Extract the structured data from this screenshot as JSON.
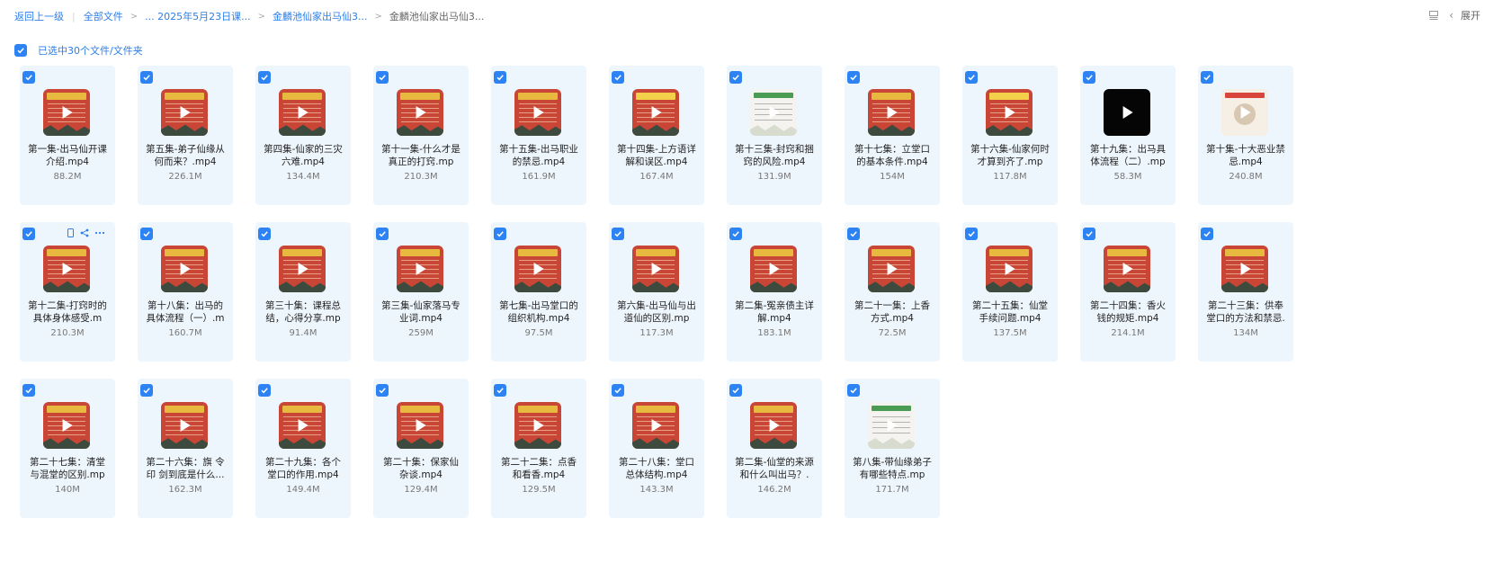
{
  "breadcrumb": {
    "back": "返回上一级",
    "items": [
      "全部文件",
      "... 2025年5月23日课...",
      "金麟池仙家出马仙3..."
    ],
    "current": "金麟池仙家出马仙3..."
  },
  "toolbar": {
    "expand_label": "展开",
    "chevron": "‹"
  },
  "selection": {
    "label": "已选中30个文件/文件夹"
  },
  "hover_icons": [
    "phone-icon",
    "share-icon",
    "more-icon"
  ],
  "files": [
    {
      "name": "第一集-出马仙开课介绍.mp4",
      "size": "88.2M",
      "thumb": "red"
    },
    {
      "name": "第五集-弟子仙缘从何而来？.mp4",
      "size": "226.1M",
      "thumb": "red"
    },
    {
      "name": "第四集-仙家的三灾六难.mp4",
      "size": "134.4M",
      "thumb": "red"
    },
    {
      "name": "第十一集-什么才是真正的打窍.mp",
      "size": "210.3M",
      "thumb": "red"
    },
    {
      "name": "第十五集-出马职业的禁忌.mp4",
      "size": "161.9M",
      "thumb": "red"
    },
    {
      "name": "第十四集-上方语详解和误区.mp4",
      "size": "167.4M",
      "thumb": "yellow"
    },
    {
      "name": "第十三集-封窍和捆窍的风险.mp4",
      "size": "131.9M",
      "thumb": "white"
    },
    {
      "name": "第十七集：立堂口的基本条件.mp4",
      "size": "154M",
      "thumb": "red"
    },
    {
      "name": "第十六集-仙家何时才算到齐了.mp",
      "size": "117.8M",
      "thumb": "yellow"
    },
    {
      "name": "第十九集：出马具体流程（二）.mp",
      "size": "58.3M",
      "thumb": "black"
    },
    {
      "name": "第十集-十大恶业禁忌.mp4",
      "size": "240.8M",
      "thumb": "portrait"
    },
    {
      "name": "第十二集-打窍时的具体身体感受.m",
      "size": "210.3M",
      "thumb": "red"
    },
    {
      "name": "第十八集：出马的具体流程（一）.m",
      "size": "160.7M",
      "thumb": "red"
    },
    {
      "name": "第三十集：课程总结，心得分享.mp",
      "size": "91.4M",
      "thumb": "red"
    },
    {
      "name": "第三集-仙家落马专业词.mp4",
      "size": "259M",
      "thumb": "red"
    },
    {
      "name": "第七集-出马堂口的组织机构.mp4",
      "size": "97.5M",
      "thumb": "red"
    },
    {
      "name": "第六集-出马仙与出道仙的区别.mp",
      "size": "117.3M",
      "thumb": "red"
    },
    {
      "name": "第二集-冤亲债主详解.mp4",
      "size": "183.1M",
      "thumb": "red"
    },
    {
      "name": "第二十一集：上香方式.mp4",
      "size": "72.5M",
      "thumb": "red"
    },
    {
      "name": "第二十五集：仙堂手续问题.mp4",
      "size": "137.5M",
      "thumb": "red"
    },
    {
      "name": "第二十四集：香火钱的规矩.mp4",
      "size": "214.1M",
      "thumb": "red"
    },
    {
      "name": "第二十三集：供奉堂口的方法和禁忌.",
      "size": "134M",
      "thumb": "red"
    },
    {
      "name": "第二十七集：清堂与混堂的区别.mp",
      "size": "140M",
      "thumb": "red"
    },
    {
      "name": "第二十六集：旗 令印 剑到底是什么...",
      "size": "162.3M",
      "thumb": "red"
    },
    {
      "name": "第二十九集：各个堂口的作用.mp4",
      "size": "149.4M",
      "thumb": "red"
    },
    {
      "name": "第二十集：保家仙杂谈.mp4",
      "size": "129.4M",
      "thumb": "red"
    },
    {
      "name": "第二十二集：点香和看香.mp4",
      "size": "129.5M",
      "thumb": "red"
    },
    {
      "name": "第二十八集：堂口总体结构.mp4",
      "size": "143.3M",
      "thumb": "red"
    },
    {
      "name": "第二集-仙堂的来源和什么叫出马？.",
      "size": "146.2M",
      "thumb": "red"
    },
    {
      "name": "第八集-带仙缘弟子有哪些特点.mp",
      "size": "171.7M",
      "thumb": "white"
    }
  ],
  "colors": {
    "accent": "#2d83f3",
    "tile_bg": "#eef6fd",
    "thumb_red": "#c94636"
  }
}
